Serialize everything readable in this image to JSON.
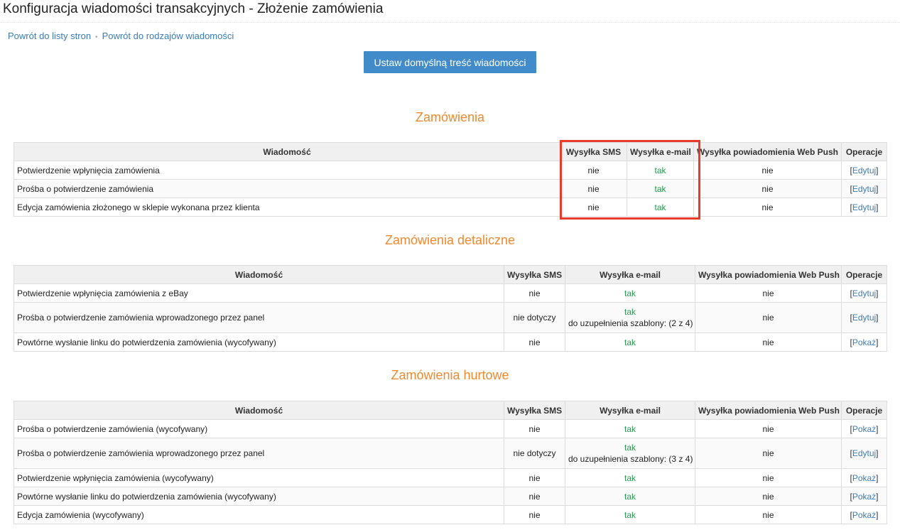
{
  "page": {
    "title": "Konfiguracja wiadomości transakcyjnych - Złożenie zamówienia"
  },
  "breadcrumbs": [
    {
      "label": "Powrót do listy stron"
    },
    {
      "label": "Powrót do rodzajów wiadomości"
    }
  ],
  "breadcrumb_separator": "•",
  "default_button_label": "Ustaw domyślną treść wiadomości",
  "colors": {
    "accent": "#428bca",
    "section_title": "#f0892e",
    "status_no": "#e2412b",
    "status_yes": "#239a4c",
    "link": "#3a7cb8",
    "highlight": "#e93a2b"
  },
  "columns": {
    "message": "Wiadomość",
    "sms": "Wysyłka SMS",
    "email": "Wysyłka e-mail",
    "webpush": "Wysyłka powiadomienia Web Push",
    "operations": "Operacje"
  },
  "sections": [
    {
      "title": "Zamówienia",
      "rows": [
        {
          "name": "Potwierdzenie wpłynięcia zamówienia",
          "sms": "nie",
          "email": "tak",
          "template_note": "",
          "webpush": "nie",
          "operation": "Edytuj"
        },
        {
          "name": "Prośba o potwierdzenie zamówienia",
          "sms": "nie",
          "email": "tak",
          "template_note": "",
          "webpush": "nie",
          "operation": "Edytuj"
        },
        {
          "name": "Edycja zamówienia złożonego w sklepie wykonana przez klienta",
          "sms": "nie",
          "email": "tak",
          "template_note": "",
          "webpush": "nie",
          "operation": "Edytuj"
        }
      ]
    },
    {
      "title": "Zamówienia detaliczne",
      "rows": [
        {
          "name": "Potwierdzenie wpłynięcia zamówienia z eBay",
          "sms": "nie",
          "email": "tak",
          "template_note": "",
          "webpush": "nie",
          "operation": "Edytuj"
        },
        {
          "name": "Prośba o potwierdzenie zamówienia wprowadzonego przez panel",
          "sms": "nie dotyczy",
          "email": "tak",
          "template_note": "do uzupełnienia szablony: (2 z 4)",
          "webpush": "nie",
          "operation": "Edytuj"
        },
        {
          "name": "Powtórne wysłanie linku do potwierdzenia zamówienia (wycofywany)",
          "sms": "nie",
          "email": "tak",
          "template_note": "",
          "webpush": "nie",
          "operation": "Pokaż"
        }
      ]
    },
    {
      "title": "Zamówienia hurtowe",
      "rows": [
        {
          "name": "Prośba o potwierdzenie zamówienia (wycofywany)",
          "sms": "nie",
          "email": "tak",
          "template_note": "",
          "webpush": "nie",
          "operation": "Pokaż"
        },
        {
          "name": "Prośba o potwierdzenie zamówienia wprowadzonego przez panel",
          "sms": "nie dotyczy",
          "email": "tak",
          "template_note": "do uzupełnienia szablony: (3 z 4)",
          "webpush": "nie",
          "operation": "Edytuj"
        },
        {
          "name": "Potwierdzenie wpłynięcia zamówienia (wycofywany)",
          "sms": "nie",
          "email": "tak",
          "template_note": "",
          "webpush": "nie",
          "operation": "Pokaż"
        },
        {
          "name": "Powtórne wysłanie linku do potwierdzenia zamówienia (wycofywany)",
          "sms": "nie",
          "email": "tak",
          "template_note": "",
          "webpush": "nie",
          "operation": "Pokaż"
        },
        {
          "name": "Edycja zamówienia (wycofywany)",
          "sms": "nie",
          "email": "tak",
          "template_note": "",
          "webpush": "nie",
          "operation": "Pokaż"
        }
      ]
    }
  ]
}
